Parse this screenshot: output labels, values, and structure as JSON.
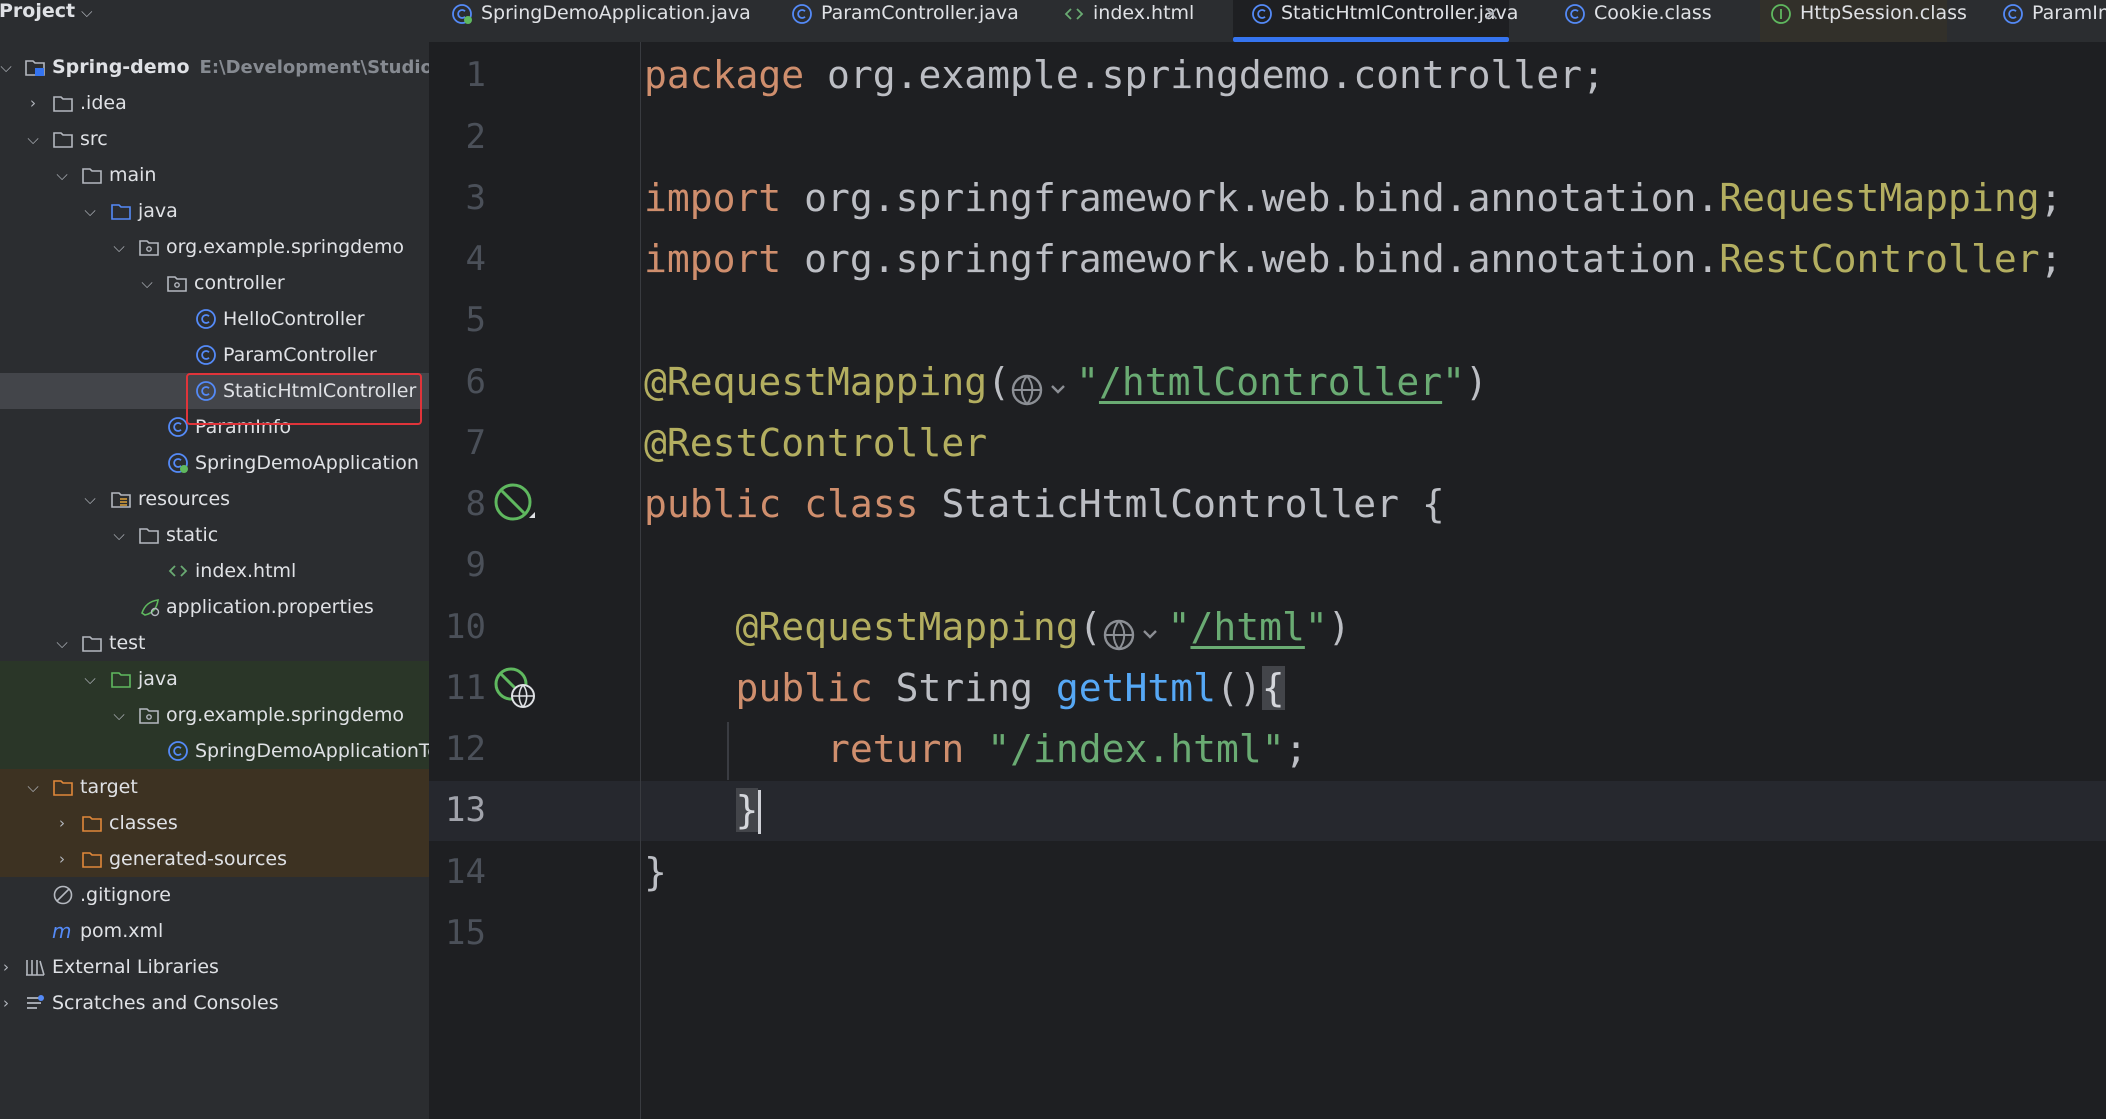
{
  "project": {
    "title": "Project",
    "tree": [
      {
        "name": "Spring-demo",
        "path": "E:\\Development\\StudioProjects"
      },
      {
        "name": ".idea"
      },
      {
        "name": "src"
      },
      {
        "name": "main"
      },
      {
        "name": "java"
      },
      {
        "name": "org.example.springdemo"
      },
      {
        "name": "controller"
      },
      {
        "name": "HelloController"
      },
      {
        "name": "ParamController"
      },
      {
        "name": "StaticHtmlController"
      },
      {
        "name": "ParamInfo"
      },
      {
        "name": "SpringDemoApplication"
      },
      {
        "name": "resources"
      },
      {
        "name": "static"
      },
      {
        "name": "index.html"
      },
      {
        "name": "application.properties"
      },
      {
        "name": "test"
      },
      {
        "name": "java"
      },
      {
        "name": "org.example.springdemo"
      },
      {
        "name": "SpringDemoApplicationTests"
      },
      {
        "name": "target"
      },
      {
        "name": "classes"
      },
      {
        "name": "generated-sources"
      },
      {
        "name": ".gitignore"
      },
      {
        "name": "pom.xml"
      },
      {
        "name": "External Libraries"
      },
      {
        "name": "Scratches and Consoles"
      }
    ]
  },
  "tabs": [
    {
      "label": "SpringDemoApplication.java"
    },
    {
      "label": "ParamController.java"
    },
    {
      "label": "index.html"
    },
    {
      "label": "StaticHtmlController.java",
      "close": "×"
    },
    {
      "label": "Cookie.class"
    },
    {
      "label": "HttpSession.class"
    },
    {
      "label": "ParamInfo.java"
    }
  ],
  "editor": {
    "line_numbers": [
      "1",
      "2",
      "3",
      "4",
      "5",
      "6",
      "7",
      "8",
      "9",
      "10",
      "11",
      "12",
      "13",
      "14",
      "15"
    ],
    "current_line": "13",
    "code": {
      "l1": {
        "kw": "package",
        "rest": " org.example.springdemo.controller;"
      },
      "l3": {
        "kw": "import",
        "pkg": " org.springframework.web.bind.annotation.",
        "cls": "RequestMapping",
        "end": ";"
      },
      "l4": {
        "kw": "import",
        "pkg": " org.springframework.web.bind.annotation.",
        "cls": "RestController",
        "end": ";"
      },
      "l6": {
        "ann": "@RequestMapping",
        "open": "(",
        "q1": "\"",
        "link": "/htmlController",
        "q2": "\"",
        "close": ")"
      },
      "l7": {
        "ann": "@RestController"
      },
      "l8": {
        "kw1": "public",
        "kw2": "class",
        "name": " StaticHtmlController {"
      },
      "l10": {
        "ann": "@RequestMapping",
        "open": "(",
        "q1": "\"",
        "link": "/html",
        "q2": "\"",
        "close": ")"
      },
      "l11": {
        "kw": "public",
        "type": " String ",
        "fn": "getHtml",
        "paren": "()",
        "brace": "{"
      },
      "l12": {
        "kw": "return",
        "str": " \"/index.html\"",
        "end": ";"
      },
      "l13": {
        "brace": "}"
      },
      "l14": {
        "brace": "}"
      }
    }
  },
  "colors": {
    "accent": "#3574f0",
    "keyword": "#cf8e6d",
    "annotation": "#b3ae60",
    "string": "#6aab73",
    "function": "#56a8f5",
    "selection_outline": "#e0343a"
  }
}
